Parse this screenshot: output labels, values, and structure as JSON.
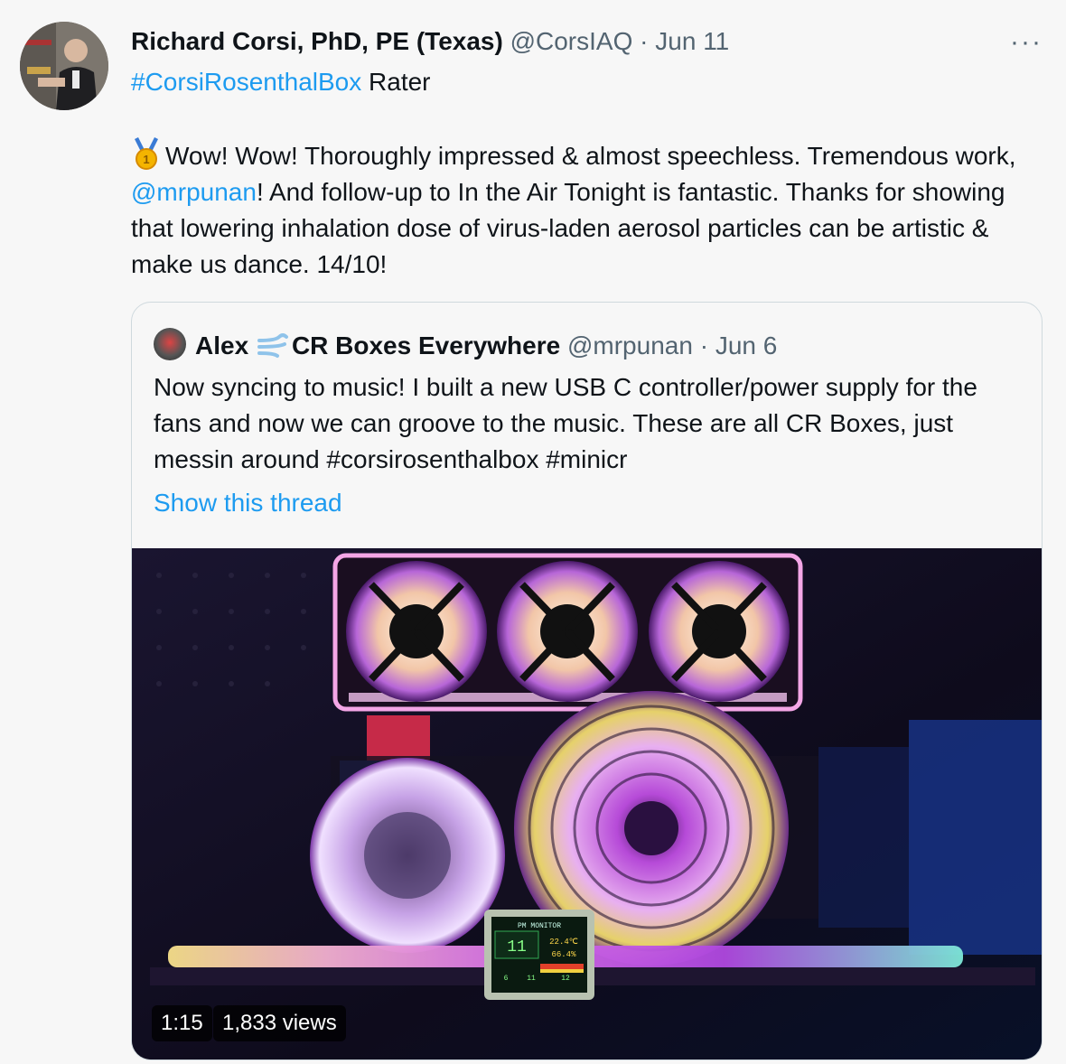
{
  "tweet": {
    "author_name": "Richard Corsi, PhD, PE (Texas)",
    "author_handle": "@CorsIAQ",
    "separator": "·",
    "date": "Jun 11",
    "more_label": "···",
    "hashtag": "#CorsiRosenthalBox",
    "hashtag_suffix": " Rater",
    "body_part1": "Wow! Wow! Thoroughly impressed & almost speechless. Tremendous work, ",
    "mention": "@mrpunan",
    "body_part2": "! And follow-up to In the Air Tonight is fantastic.  Thanks for showing that lowering inhalation dose of virus-laden aerosol particles can be artistic & make us dance.  14/10!"
  },
  "quoted": {
    "name_part1": "Alex",
    "name_part2": "CR Boxes Everywhere",
    "handle": "@mrpunan",
    "separator": "·",
    "date": "Jun 6",
    "text": "Now syncing to music! I built a new USB C controller/power supply for the fans and now we can groove to the music. These are all CR Boxes, just messin around #corsirosenthalbox #minicr",
    "show_thread": "Show this thread"
  },
  "video": {
    "duration": "1:15",
    "views": "1,833 views",
    "monitor_title": "PM MONITOR",
    "monitor_value_1": "11",
    "monitor_value_2": "22.4℃",
    "monitor_value_3": "66.4%",
    "monitor_value_4": "6",
    "monitor_value_5": "11",
    "monitor_value_6": "12"
  },
  "colors": {
    "link": "#1d9bf0",
    "muted": "#536471",
    "border": "#cfd9de"
  }
}
